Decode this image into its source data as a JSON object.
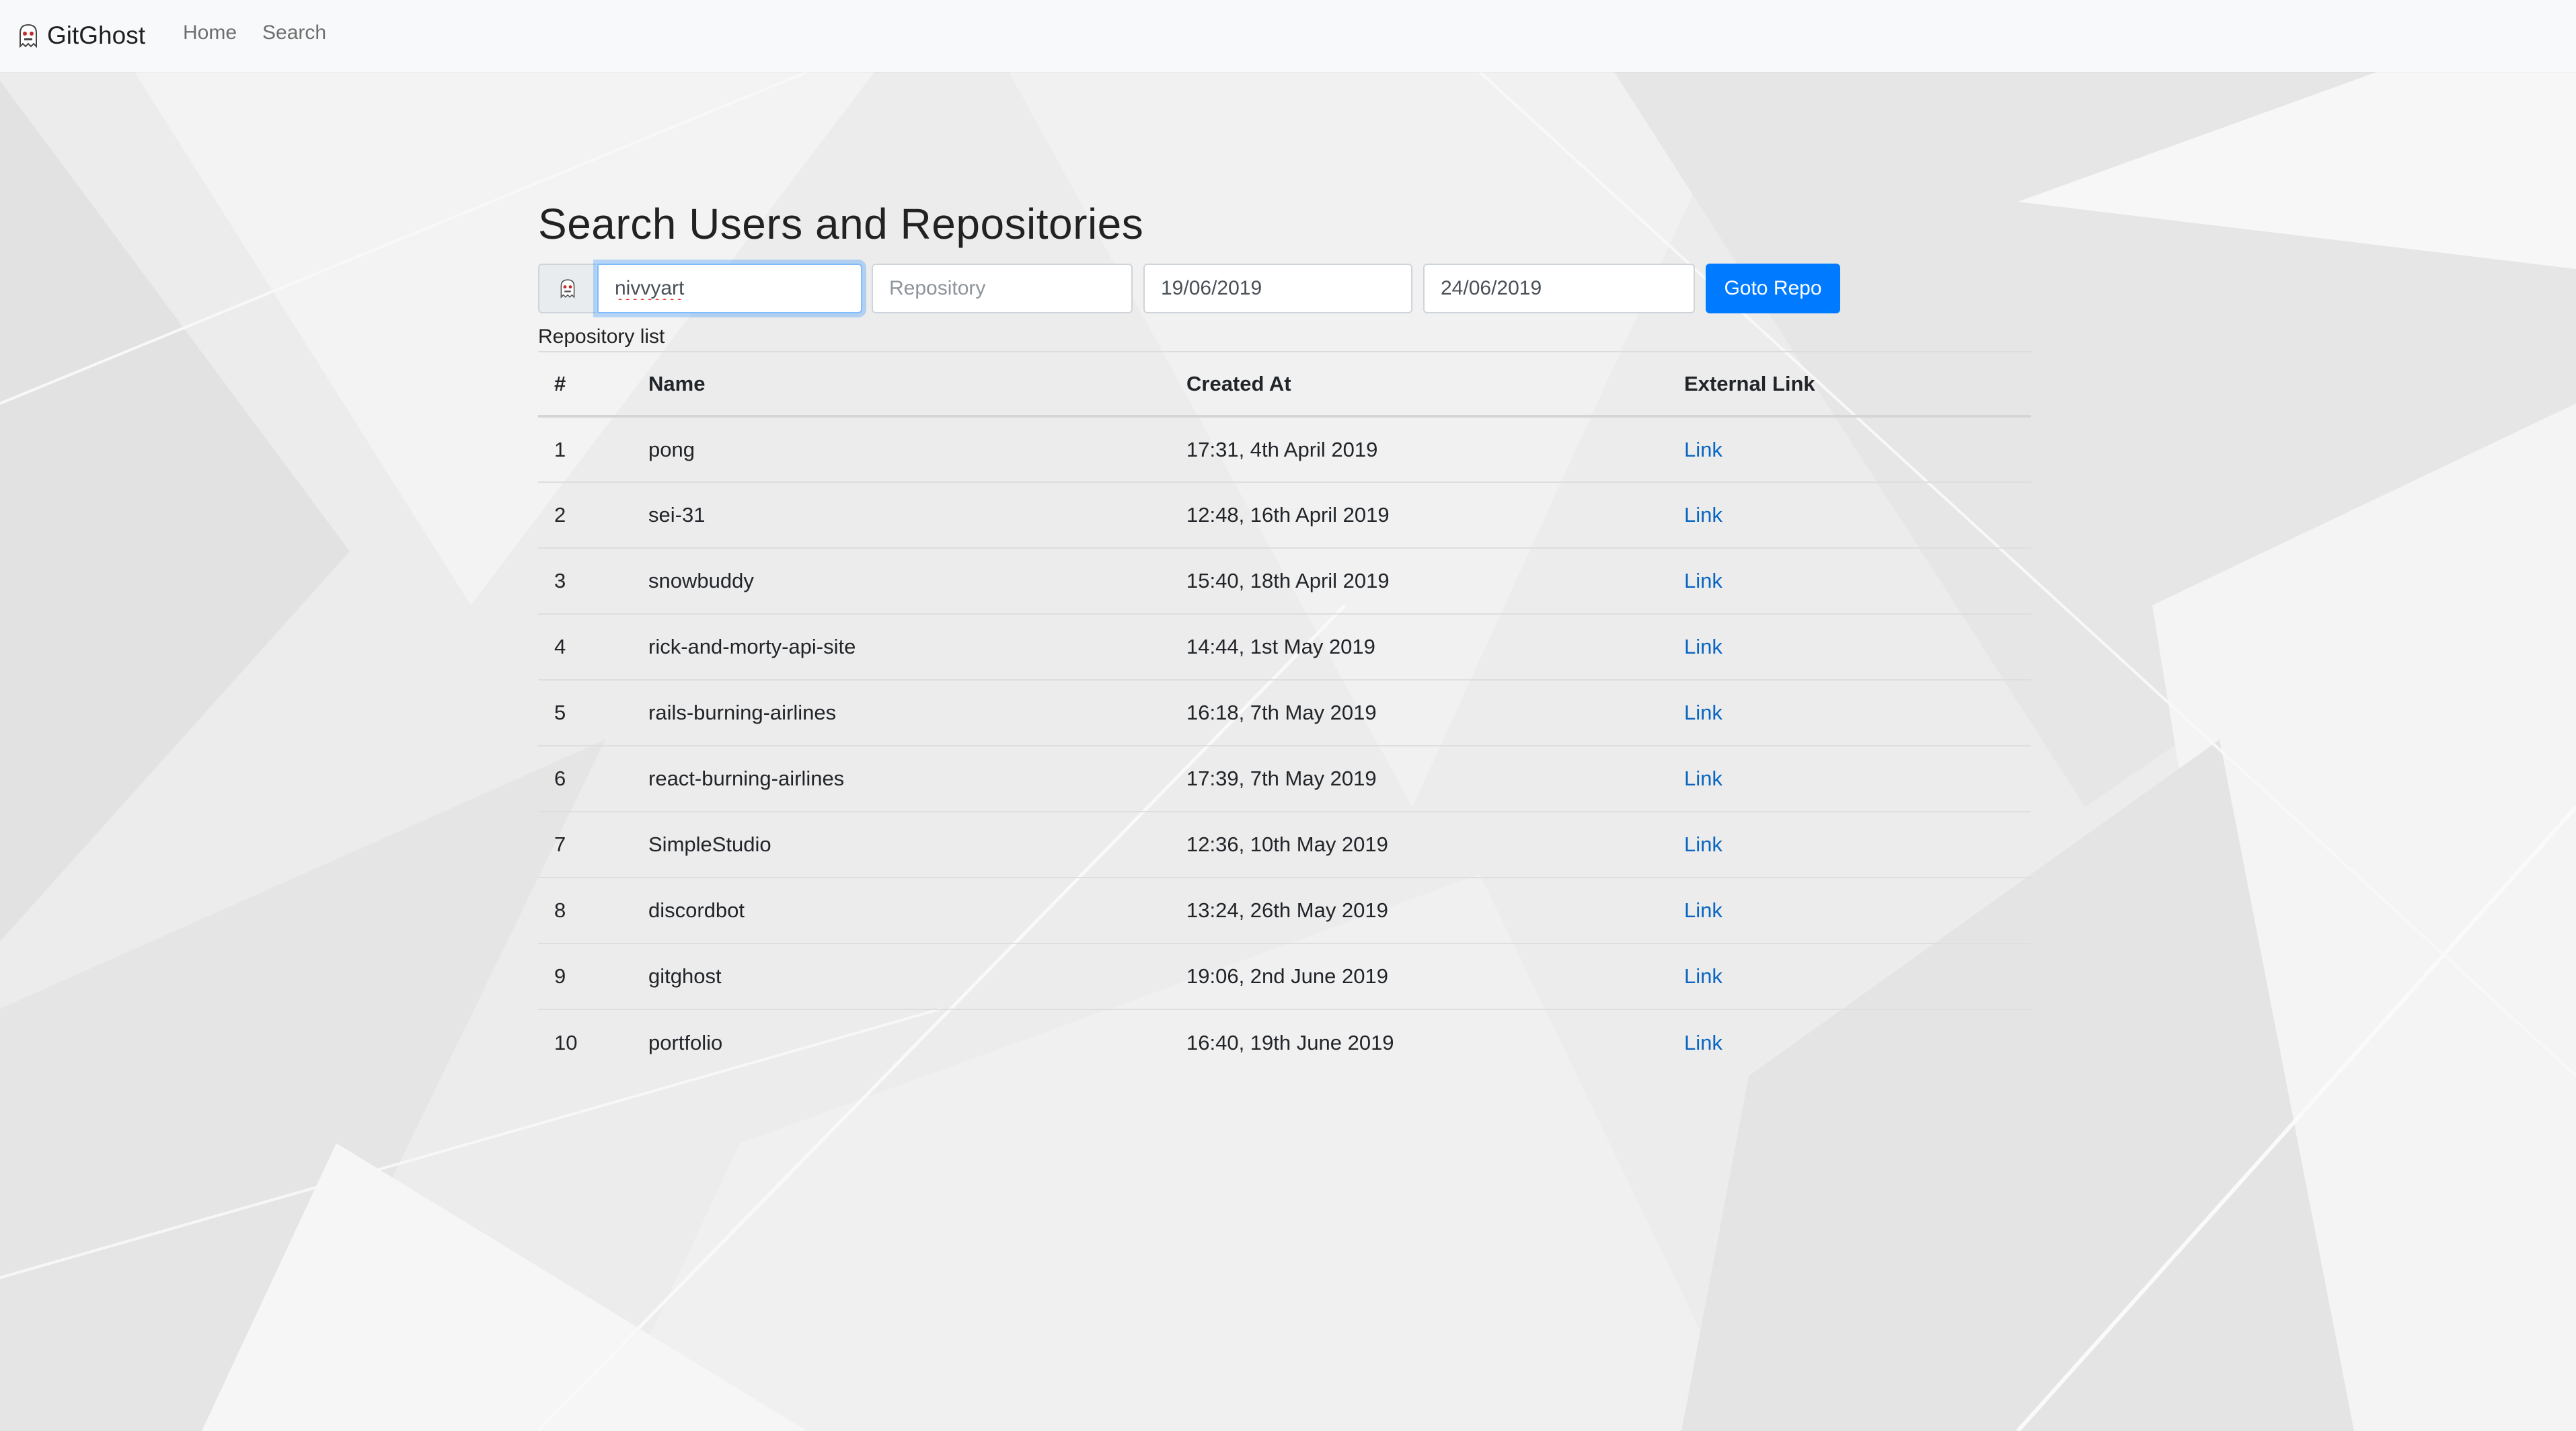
{
  "navbar": {
    "brand": "GitGhost",
    "brand_icon": "ghost-logo-icon",
    "links": [
      "Home",
      "Search"
    ]
  },
  "page": {
    "title": "Search Users and Repositories"
  },
  "search": {
    "prepend_icon": "ghost-logo-icon",
    "username_value": "nivvyart",
    "repository_placeholder": "Repository",
    "date_from_value": "19/06/2019",
    "date_to_value": "24/06/2019",
    "goto_button": "Goto Repo"
  },
  "repo_list": {
    "caption": "Repository list",
    "headers": [
      "#",
      "Name",
      "Created At",
      "External Link"
    ],
    "rows": [
      {
        "num": "1",
        "name": "pong",
        "created": "17:31, 4th April 2019",
        "link": "Link"
      },
      {
        "num": "2",
        "name": "sei-31",
        "created": "12:48, 16th April 2019",
        "link": "Link"
      },
      {
        "num": "3",
        "name": "snowbuddy",
        "created": "15:40, 18th April 2019",
        "link": "Link"
      },
      {
        "num": "4",
        "name": "rick-and-morty-api-site",
        "created": "14:44, 1st May 2019",
        "link": "Link"
      },
      {
        "num": "5",
        "name": "rails-burning-airlines",
        "created": "16:18, 7th May 2019",
        "link": "Link"
      },
      {
        "num": "6",
        "name": "react-burning-airlines",
        "created": "17:39, 7th May 2019",
        "link": "Link"
      },
      {
        "num": "7",
        "name": "SimpleStudio",
        "created": "12:36, 10th May 2019",
        "link": "Link"
      },
      {
        "num": "8",
        "name": "discordbot",
        "created": "13:24, 26th May 2019",
        "link": "Link"
      },
      {
        "num": "9",
        "name": "gitghost",
        "created": "19:06, 2nd June 2019",
        "link": "Link"
      },
      {
        "num": "10",
        "name": "portfolio",
        "created": "16:40, 19th June 2019",
        "link": "Link"
      }
    ]
  },
  "colors": {
    "accent": "#007bff",
    "link": "#0a66c2",
    "navbar_bg": "#f8f9fa",
    "page_bg": "#ececec"
  }
}
